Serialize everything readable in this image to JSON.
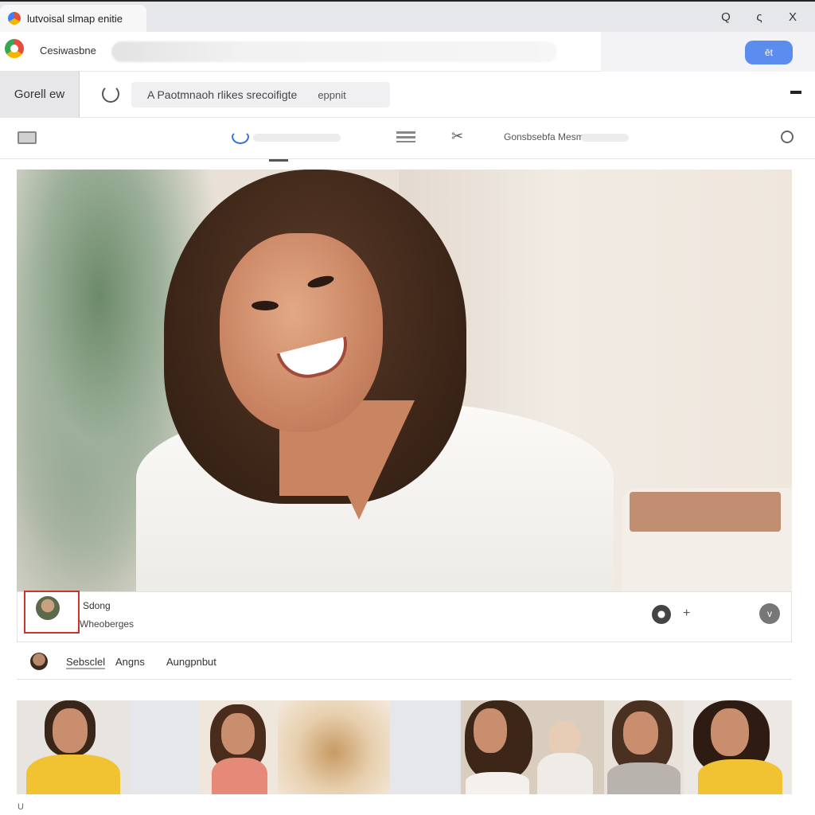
{
  "browser": {
    "tab_title": "lutvoisal slmap enitie",
    "controls": {
      "minimize": "Q",
      "back": "ς",
      "close": "X"
    }
  },
  "address": {
    "site_name": "Cesiwasbne",
    "action_button": "ēt"
  },
  "toolbar": {
    "side_tab": "Gorell ew",
    "info_text": "A Paotmnaoh rlikes srecoifigte",
    "info_sub": "eppnit"
  },
  "iconrow": {
    "filter_label": "Gonsbsebfa Mesme"
  },
  "card": {
    "title": "Sdong",
    "subtitle": "Wheoberges",
    "menu_glyph": "v"
  },
  "tabs": {
    "search": "Sebsclel",
    "images": "Angns",
    "more": "Aungpnbut"
  },
  "footer": {
    "mark": "U"
  },
  "colors": {
    "accent": "#5b8def",
    "highlight_frame": "#c9342c"
  }
}
